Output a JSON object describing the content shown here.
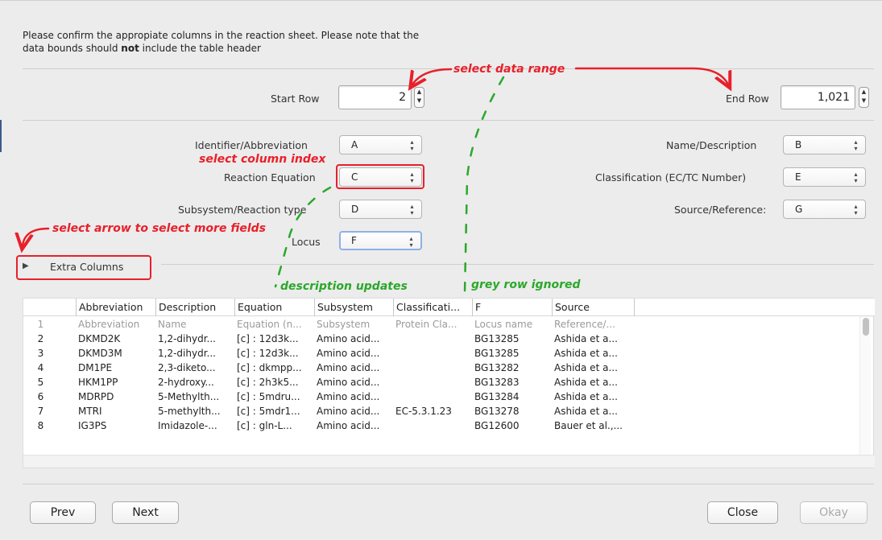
{
  "instructions": {
    "line1": "Please confirm the appropiate columns in the reaction sheet. Please note that the",
    "line2_pre": "data bounds should ",
    "line2_bold": "not",
    "line2_post": " include the table header"
  },
  "rows": {
    "start_label": "Start Row",
    "start_value": "2",
    "end_label": "End Row",
    "end_value": "1,021"
  },
  "columns": {
    "identifier": {
      "label": "Identifier/Abbreviation",
      "value": "A"
    },
    "equation": {
      "label": "Reaction Equation",
      "value": "C"
    },
    "subsystem": {
      "label": "Subsystem/Reaction type",
      "value": "D"
    },
    "locus": {
      "label": "Locus",
      "value": "F"
    },
    "name": {
      "label": "Name/Description",
      "value": "B"
    },
    "classification": {
      "label": "Classification (EC/TC Number)",
      "value": "E"
    },
    "source": {
      "label": "Source/Reference:",
      "value": "G"
    }
  },
  "extra_columns_label": "Extra Columns",
  "annotations": {
    "select_data_range": "select data range",
    "select_column_index": "select column index",
    "select_arrow": "select arrow to select more fields",
    "description_updates": "description updates",
    "grey_row_ignored": "grey row ignored"
  },
  "table": {
    "headers": [
      "Abbreviation",
      "Description",
      "Equation",
      "Subsystem",
      "Classificati...",
      "F",
      "Source"
    ],
    "rows": [
      {
        "n": "1",
        "cells": [
          "Abbreviation",
          "Name",
          "Equation (n...",
          "Subsystem",
          "Protein Cla...",
          "Locus name",
          "Reference/..."
        ]
      },
      {
        "n": "2",
        "cells": [
          "DKMD2K",
          "1,2-dihydr...",
          "[c] : 12d3k...",
          "Amino acid...",
          "",
          "BG13285",
          "Ashida et a..."
        ]
      },
      {
        "n": "3",
        "cells": [
          "DKMD3M",
          "1,2-dihydr...",
          "[c] : 12d3k...",
          "Amino acid...",
          "",
          "BG13285",
          "Ashida et a..."
        ]
      },
      {
        "n": "4",
        "cells": [
          "DM1PE",
          "2,3-diketo...",
          "[c] : dkmpp...",
          "Amino acid...",
          "",
          "BG13282",
          "Ashida et a..."
        ]
      },
      {
        "n": "5",
        "cells": [
          "HKM1PP",
          "2-hydroxy...",
          "[c] : 2h3k5...",
          "Amino acid...",
          "",
          "BG13283",
          "Ashida et a..."
        ]
      },
      {
        "n": "6",
        "cells": [
          "MDRPD",
          "5-Methylth...",
          "[c] : 5mdru...",
          "Amino acid...",
          "",
          "BG13284",
          "Ashida et a..."
        ]
      },
      {
        "n": "7",
        "cells": [
          "MTRI",
          "5-methylth...",
          "[c] : 5mdr1...",
          "Amino acid...",
          "EC-5.3.1.23",
          "BG13278",
          "Ashida et a..."
        ]
      },
      {
        "n": "8",
        "cells": [
          "IG3PS",
          "Imidazole-...",
          "[c] : gln-L...",
          "Amino acid...",
          "",
          "BG12600",
          "Bauer et al.,..."
        ]
      }
    ]
  },
  "buttons": {
    "prev": "Prev",
    "next": "Next",
    "close": "Close",
    "okay": "Okay"
  },
  "colors": {
    "annotation_red": "#e8202a",
    "annotation_green": "#2aa82a",
    "focus_blue": "#8fb0e6"
  }
}
